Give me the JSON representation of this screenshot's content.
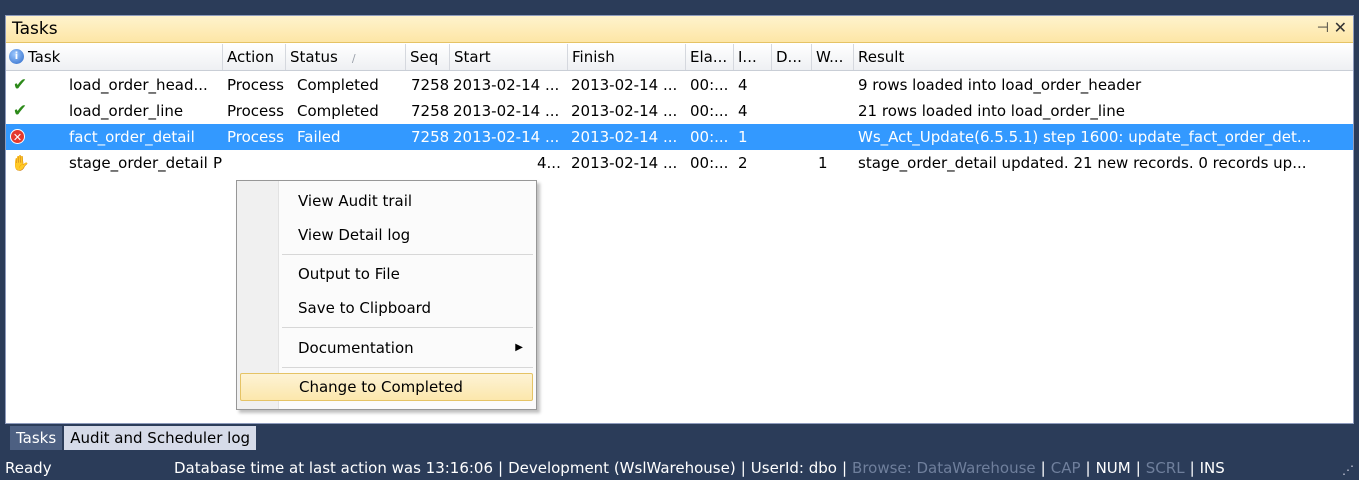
{
  "panel": {
    "title": "Tasks",
    "pin_glyph": "⊣",
    "close_glyph": "✕"
  },
  "columns": [
    {
      "label": "Task"
    },
    {
      "label": "Action"
    },
    {
      "label": "Status"
    },
    {
      "label": "Seq"
    },
    {
      "label": "Start"
    },
    {
      "label": "Finish"
    },
    {
      "label": "Ela..."
    },
    {
      "label": "I..."
    },
    {
      "label": "D..."
    },
    {
      "label": "W..."
    },
    {
      "label": "Result"
    }
  ],
  "status_sort_indicator": "∕",
  "rows": [
    {
      "icon": "checkmark-icon",
      "task": "load_order_head...",
      "action": "Process",
      "status": "Completed",
      "seq": "7258",
      "start": "2013-02-14 ...",
      "finish": "2013-02-14 ...",
      "elapsed": "00:...",
      "i": "4",
      "d": "",
      "w": "",
      "result": "9 rows loaded into load_order_header"
    },
    {
      "icon": "checkmark-icon",
      "task": "load_order_line",
      "action": "Process",
      "status": "Completed",
      "seq": "7258",
      "start": "2013-02-14 ...",
      "finish": "2013-02-14 ...",
      "elapsed": "00:...",
      "i": "4",
      "d": "",
      "w": "",
      "result": "21 rows loaded into load_order_line"
    },
    {
      "icon": "failed-icon",
      "task": "fact_order_detail",
      "action": "Process",
      "status": "Failed",
      "seq": "7258",
      "start": "2013-02-14 ...",
      "finish": "2013-02-14 ...",
      "elapsed": "00:...",
      "i": "1",
      "d": "",
      "w": "",
      "result": "Ws_Act_Update(6.5.5.1) step 1600: update_fact_order_det..."
    },
    {
      "icon": "hand-icon",
      "task": "stage_order_detail",
      "action": "P",
      "status": "",
      "seq": "",
      "start": "4...",
      "finish": "2013-02-14 ...",
      "elapsed": "00:...",
      "i": "2",
      "d": "",
      "w": "1",
      "result": "stage_order_detail updated. 21 new records. 0 records up..."
    }
  ],
  "context_menu": {
    "view_audit": "View Audit trail",
    "view_detail": "View Detail log",
    "output_file": "Output to File",
    "save_clipboard": "Save to Clipboard",
    "documentation": "Documentation",
    "submenu_arrow": "▶",
    "change_completed": "Change to Completed"
  },
  "bottom_tabs": {
    "tasks": "Tasks",
    "audit": "Audit and Scheduler log"
  },
  "statusbar": {
    "ready": "Ready",
    "db_time": "Database time at last action was 13:16:06",
    "connection": "Development (WslWarehouse)",
    "user": "UserId: dbo",
    "browse": "Browse: DataWarehouse",
    "cap": "CAP",
    "num": "NUM",
    "scrl": "SCRL",
    "ins": "INS",
    "divider": "|"
  }
}
